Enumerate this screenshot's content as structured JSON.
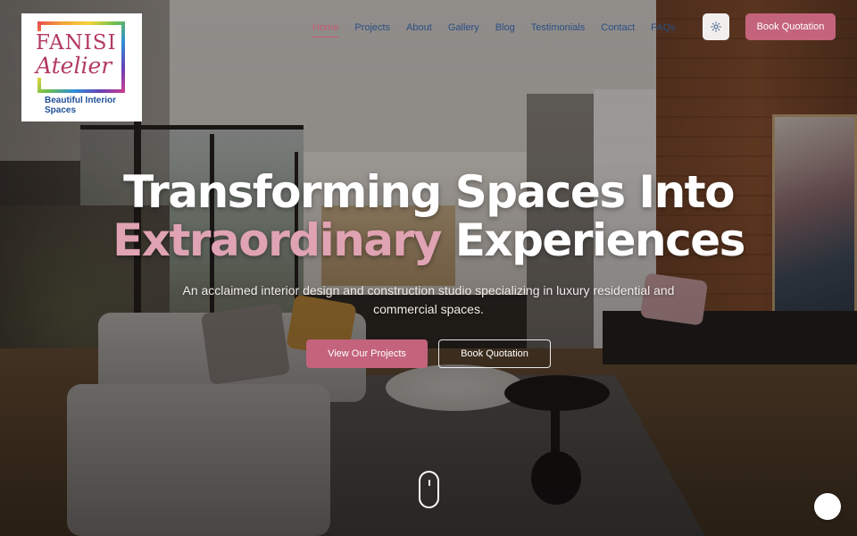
{
  "brand": {
    "name_line1": "FANISI",
    "name_line2": "Atelier",
    "tagline": "Beautiful Interior Spaces"
  },
  "nav": {
    "items": [
      {
        "label": "Home",
        "active": true
      },
      {
        "label": "Projects",
        "active": false
      },
      {
        "label": "About",
        "active": false
      },
      {
        "label": "Gallery",
        "active": false
      },
      {
        "label": "Blog",
        "active": false
      },
      {
        "label": "Testimonials",
        "active": false
      },
      {
        "label": "Contact",
        "active": false
      },
      {
        "label": "FAQs",
        "active": false
      }
    ],
    "theme_toggle_icon": "sun-icon",
    "cta_label": "Book Quotation"
  },
  "hero": {
    "title_line1": "Transforming Spaces Into",
    "title_accent": "Extraordinary",
    "title_line2_rest": " Experiences",
    "subtitle": "An acclaimed interior design and construction studio specializing in luxury residential and commercial spaces.",
    "primary_button": "View Our Projects",
    "secondary_button": "Book Quotation",
    "scroll_icon": "mouse-scroll-icon"
  },
  "floating": {
    "back_to_top_icon": "arrow-up-icon"
  },
  "colors": {
    "accent": "#c4637c",
    "accent_light": "#e0a3b3",
    "nav_text": "#2a4f86",
    "logo_text": "#b23a63",
    "logo_tagline": "#1f4f98"
  }
}
